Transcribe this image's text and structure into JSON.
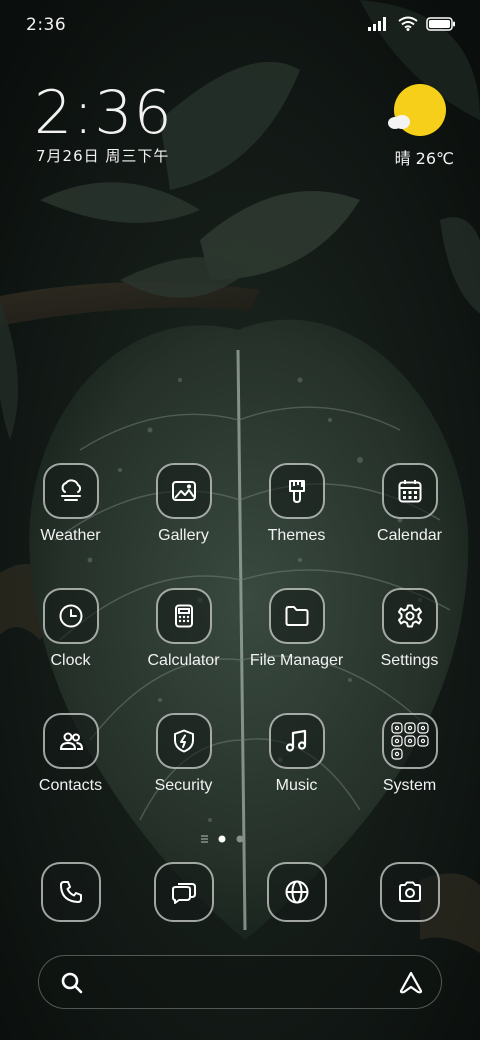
{
  "status_bar": {
    "time": "2:36",
    "icons": [
      "signal-icon",
      "wifi-icon",
      "battery-icon"
    ]
  },
  "clock_widget": {
    "time": "2:36",
    "date": "7月26日 周三下午"
  },
  "weather_widget": {
    "condition_icon": "partly-sunny-icon",
    "temperature": "晴 26℃",
    "sun_color": "#f6cf1a"
  },
  "apps": [
    {
      "label": "Weather",
      "icon": "weather-icon"
    },
    {
      "label": "Gallery",
      "icon": "gallery-icon"
    },
    {
      "label": "Themes",
      "icon": "themes-icon"
    },
    {
      "label": "Calendar",
      "icon": "calendar-icon"
    },
    {
      "label": "Clock",
      "icon": "clock-icon"
    },
    {
      "label": "Calculator",
      "icon": "calculator-icon"
    },
    {
      "label": "File Manager",
      "icon": "folder-icon"
    },
    {
      "label": "Settings",
      "icon": "gear-icon"
    },
    {
      "label": "Contacts",
      "icon": "contacts-icon"
    },
    {
      "label": "Security",
      "icon": "security-icon"
    },
    {
      "label": "Music",
      "icon": "music-icon"
    },
    {
      "label": "System",
      "icon": "folder-grid-icon"
    }
  ],
  "page_indicator": {
    "pages": 2,
    "current": 1
  },
  "dock": [
    {
      "icon": "phone-icon"
    },
    {
      "icon": "messages-icon"
    },
    {
      "icon": "browser-icon"
    },
    {
      "icon": "camera-icon"
    }
  ],
  "search_bar": {
    "icon": "search-icon",
    "assistant_icon": "assistant-icon"
  }
}
